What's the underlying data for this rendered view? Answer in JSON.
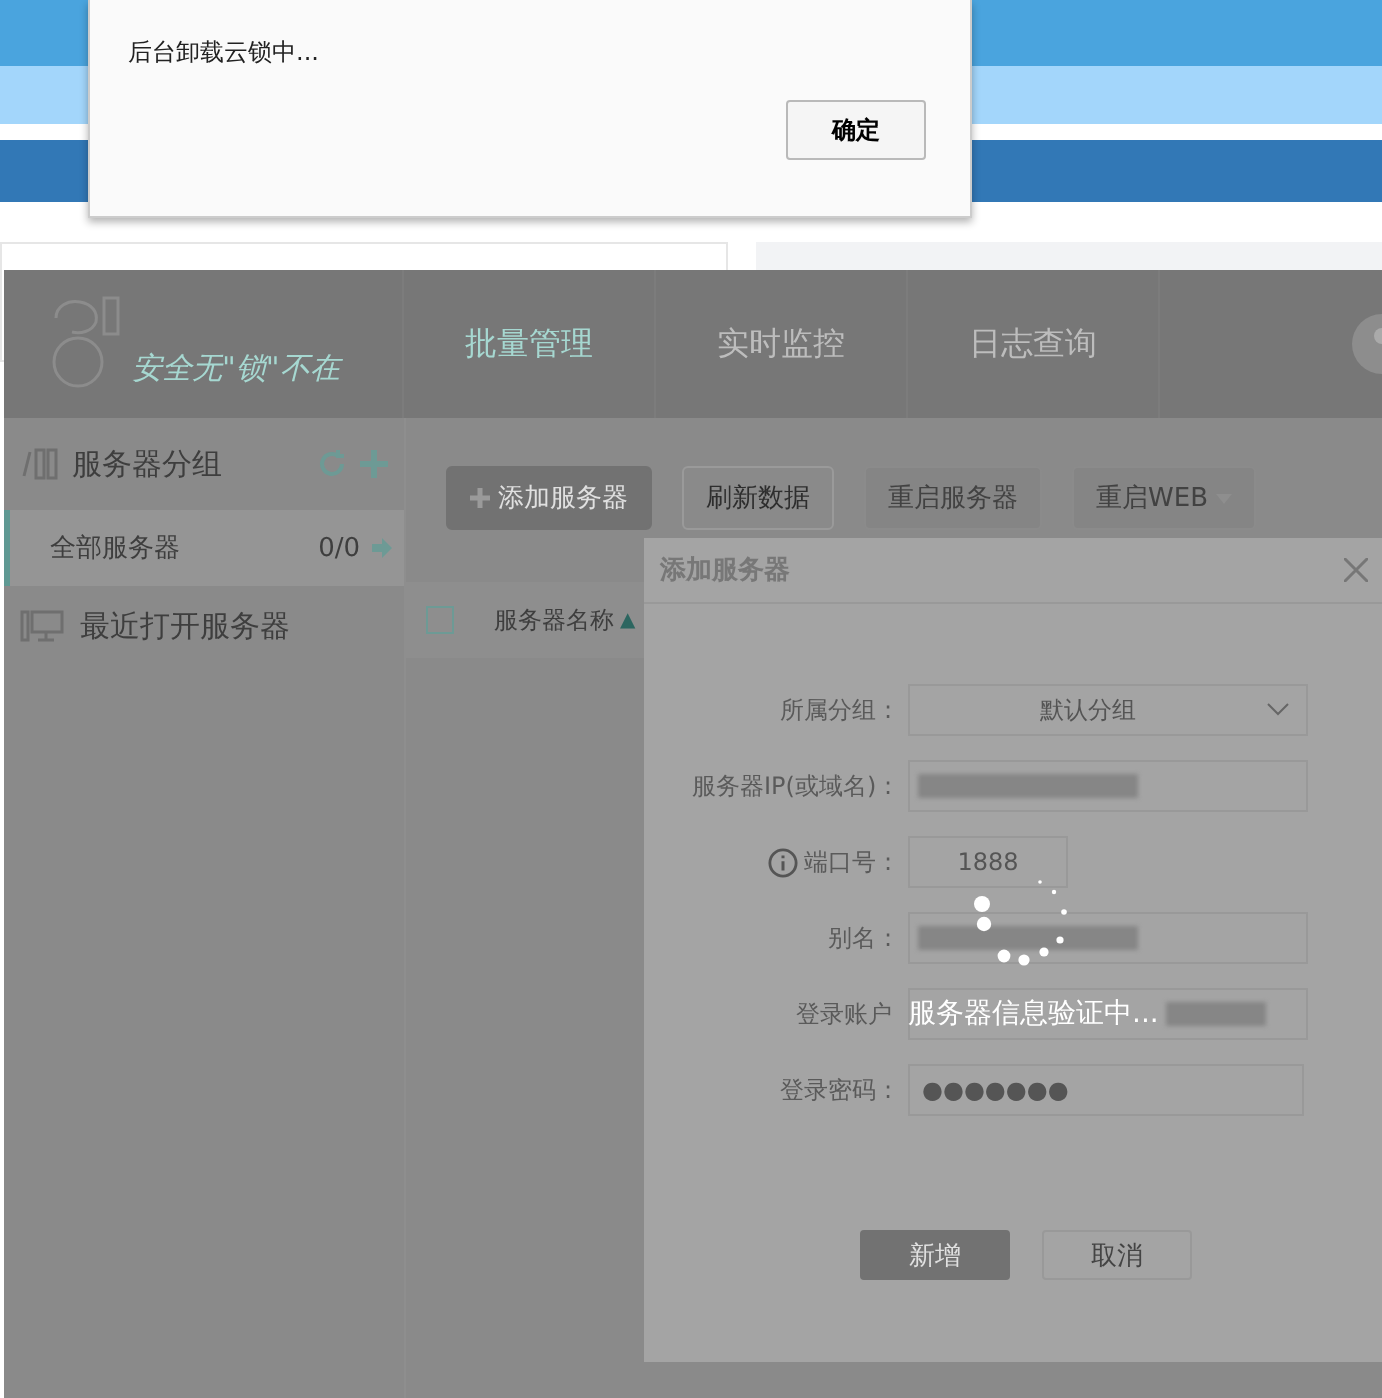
{
  "alert": {
    "message": "后台卸载云锁中...",
    "button": "确定"
  },
  "app": {
    "slogan": "安全无\"锁\"不在",
    "nav": [
      {
        "label": "批量管理",
        "selected": true
      },
      {
        "label": "实时监控",
        "selected": false
      },
      {
        "label": "日志查询",
        "selected": false
      }
    ],
    "sidebar": {
      "group_title": "服务器分组",
      "items": [
        {
          "label": "全部服务器",
          "count": "0/0",
          "selected": true
        }
      ],
      "recent": "最近打开服务器"
    },
    "toolbar": [
      {
        "label": "添加服务器",
        "kind": "primary"
      },
      {
        "label": "刷新数据",
        "kind": "outline"
      },
      {
        "label": "重启服务器",
        "kind": "disabled"
      },
      {
        "label": "重启WEB",
        "kind": "dropdown"
      }
    ],
    "table": {
      "select_all_checked": false,
      "columns": [
        {
          "label": "服务器名称",
          "sort": "▲"
        }
      ]
    }
  },
  "modal": {
    "title": "添加服务器",
    "fields": [
      {
        "label": "所属分组 :",
        "kind": "select",
        "value": "默认分组"
      },
      {
        "label": "服务器IP(或域名) :",
        "kind": "blurred"
      },
      {
        "label": "端口号 :",
        "kind": "port",
        "value": "1888"
      },
      {
        "label": "别名 :",
        "kind": "blurred"
      },
      {
        "label": "登录账户",
        "kind": "blurred_tail"
      },
      {
        "label": "登录密码 :",
        "kind": "password",
        "value": "●●●●●●●"
      }
    ],
    "buttons": [
      {
        "label": "新增",
        "kind": "primary"
      },
      {
        "label": "取消",
        "kind": "outline"
      }
    ],
    "loading": "服务器信息验证中..."
  }
}
